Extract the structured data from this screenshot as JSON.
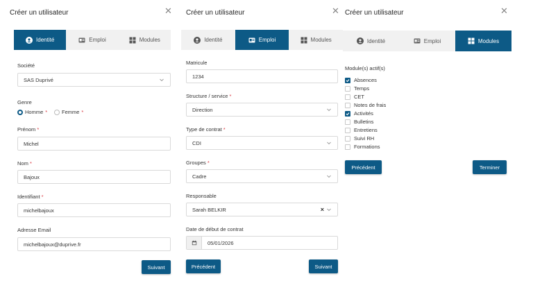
{
  "dialog_title": "Créer un utilisateur",
  "close_glyph": "✕",
  "tabs": [
    "Identité",
    "Emploi",
    "Modules"
  ],
  "accent_color": "#0d5a86",
  "required_color": "#d9363e",
  "identity": {
    "societe_label": "Société",
    "societe_value": "SAS Duprivé",
    "genre_label": "Genre",
    "genre_options": [
      "Homme",
      "Femme"
    ],
    "genre_selected": "Homme",
    "prenom_label": "Prénom",
    "prenom_value": "Michel",
    "nom_label": "Nom",
    "nom_value": "Bajoux",
    "identifiant_label": "Identifiant",
    "identifiant_value": "michelbajoux",
    "email_label": "Adresse Email",
    "email_value": "michelbajoux@duprive.fr",
    "next_label": "Suivant"
  },
  "emploi": {
    "matricule_label": "Matricule",
    "matricule_value": "1234",
    "structure_label": "Structure / service",
    "structure_value": "Direction",
    "contrat_label": "Type de contrat",
    "contrat_value": "CDI",
    "groupes_label": "Groupes",
    "groupes_value": "Cadre",
    "responsable_label": "Responsable",
    "responsable_value": "Sarah BELKIR",
    "date_label": "Date de début de contrat",
    "date_value": "05/01/2026",
    "prev_label": "Précédent",
    "next_label": "Suivant"
  },
  "modules": {
    "heading": "Module(s) actif(s)",
    "items": [
      {
        "label": "Absences",
        "checked": true
      },
      {
        "label": "Temps",
        "checked": false
      },
      {
        "label": "CET",
        "checked": false
      },
      {
        "label": "Notes de frais",
        "checked": false
      },
      {
        "label": "Activités",
        "checked": true
      },
      {
        "label": "Bulletins",
        "checked": false
      },
      {
        "label": "Entretiens",
        "checked": false
      },
      {
        "label": "Suivi RH",
        "checked": false
      },
      {
        "label": "Formations",
        "checked": false
      }
    ],
    "prev_label": "Précédent",
    "finish_label": "Terminer"
  }
}
